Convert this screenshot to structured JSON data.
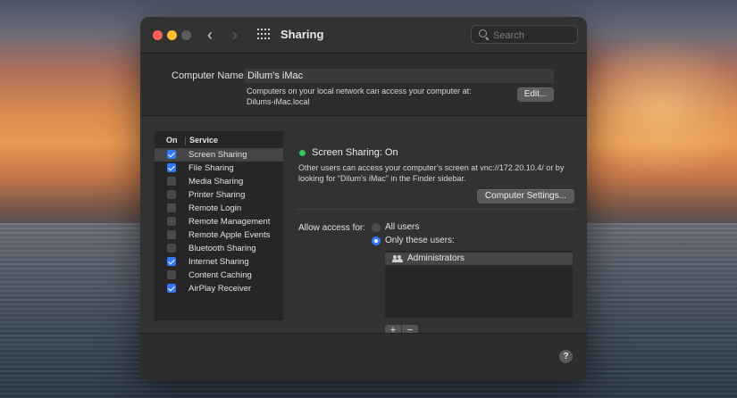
{
  "window": {
    "title": "Sharing",
    "search": {
      "placeholder": "Search",
      "value": ""
    }
  },
  "computer": {
    "name_label": "Computer Name:",
    "name_value": "Dilum’s iMac",
    "desc_line1": "Computers on your local network can access your computer at:",
    "desc_line2": "Dilums-iMac.local",
    "edit_label": "Edit..."
  },
  "services": {
    "header_on": "On",
    "header_service": "Service",
    "items": [
      {
        "label": "Screen Sharing",
        "checked": true,
        "selected": true
      },
      {
        "label": "File Sharing",
        "checked": true,
        "selected": false
      },
      {
        "label": "Media Sharing",
        "checked": false,
        "selected": false
      },
      {
        "label": "Printer Sharing",
        "checked": false,
        "selected": false
      },
      {
        "label": "Remote Login",
        "checked": false,
        "selected": false
      },
      {
        "label": "Remote Management",
        "checked": false,
        "selected": false
      },
      {
        "label": "Remote Apple Events",
        "checked": false,
        "selected": false
      },
      {
        "label": "Bluetooth Sharing",
        "checked": false,
        "selected": false
      },
      {
        "label": "Internet Sharing",
        "checked": true,
        "selected": false
      },
      {
        "label": "Content Caching",
        "checked": false,
        "selected": false
      },
      {
        "label": "AirPlay Receiver",
        "checked": true,
        "selected": false
      }
    ]
  },
  "detail": {
    "status_text": "Screen Sharing: On",
    "status_color": "#34c759",
    "desc_line1": "Other users can access your computer’s screen at vnc://172.20.10.4/ or by",
    "desc_line2": "looking for “Dilum’s iMac” in the Finder sidebar.",
    "computer_settings_label": "Computer Settings...",
    "allow_label": "Allow access for:",
    "option_all": "All users",
    "option_only": "Only these users:",
    "selected_option": "only",
    "users": [
      "Administrators"
    ],
    "add_label": "+",
    "remove_label": "−"
  },
  "help_label": "?",
  "accent_color": "#3478f6"
}
